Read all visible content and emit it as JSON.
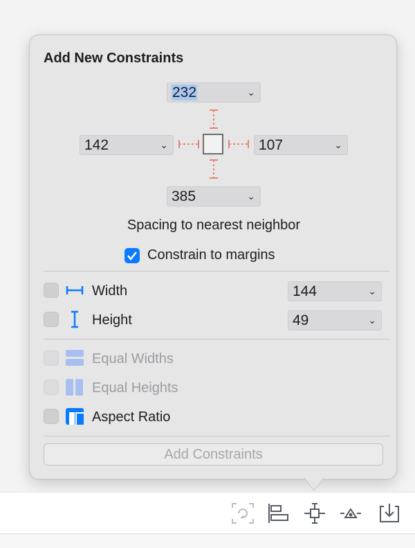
{
  "popover": {
    "title": "Add New Constraints",
    "spacing": {
      "top": "232",
      "left": "142",
      "right": "107",
      "bottom": "385",
      "caption": "Spacing to nearest neighbor"
    },
    "constrain_to_margins": {
      "label": "Constrain to margins",
      "checked": true
    },
    "size": [
      {
        "label": "Width",
        "value": "144",
        "icon": "width-icon",
        "checked": false
      },
      {
        "label": "Height",
        "value": "49",
        "icon": "height-icon",
        "checked": false
      }
    ],
    "relations": [
      {
        "label": "Equal Widths",
        "icon": "equal-widths-icon",
        "enabled": false
      },
      {
        "label": "Equal Heights",
        "icon": "equal-heights-icon",
        "enabled": false
      },
      {
        "label": "Aspect Ratio",
        "icon": "aspect-ratio-icon",
        "enabled": true
      }
    ],
    "add_button": "Add Constraints"
  },
  "toolbar": {
    "icons": [
      "update-frames-icon",
      "align-icon",
      "add-constraints-icon",
      "resolve-issues-icon",
      "embed-in-icon"
    ]
  },
  "colors": {
    "accent": "#0a7aff",
    "strut": "#e8847a",
    "selection": "#a8c9f5"
  }
}
